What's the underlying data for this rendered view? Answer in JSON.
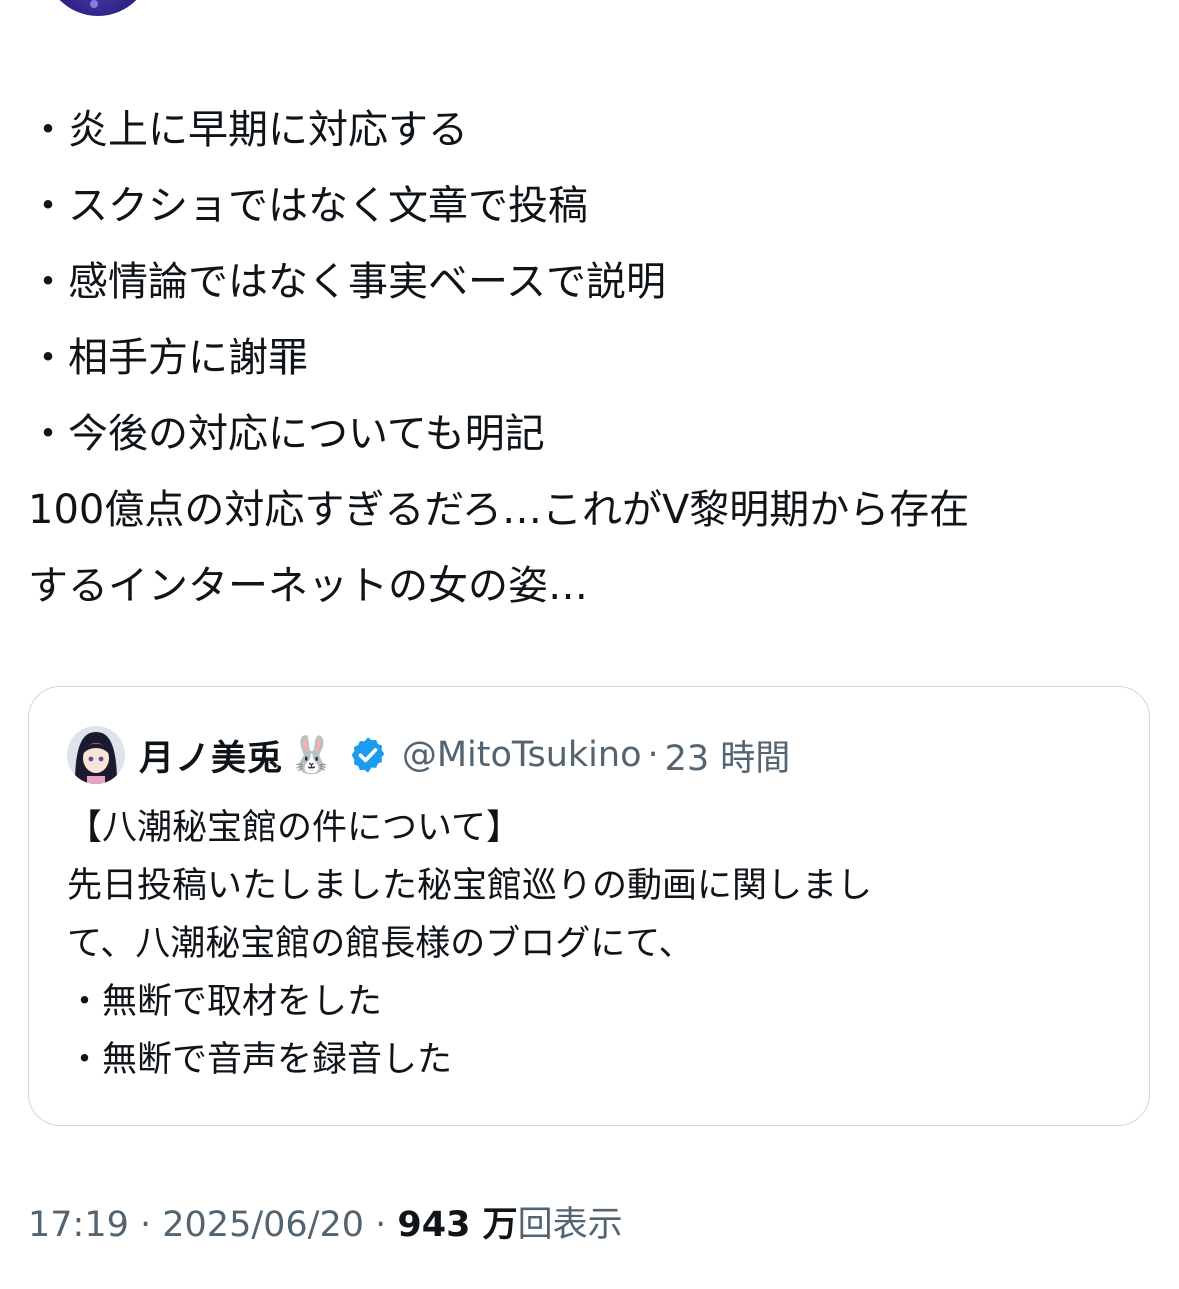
{
  "tweet": {
    "bullets": [
      "・炎上に早期に対応する",
      "・スクショではなく文章で投稿",
      "・感情論ではなく事実ベースで説明",
      "・相手方に謝罪",
      "・今後の対応についても明記"
    ],
    "body_lines": [
      "100億点の対応すぎるだろ…これがV黎明期から存在",
      "するインターネットの女の姿…"
    ]
  },
  "quote": {
    "name": "月ノ美兎",
    "name_emoji": "🐰",
    "handle": "@MitoTsukino",
    "separator": "·",
    "time": "23 時間",
    "lines": [
      "【八潮秘宝館の件について】",
      "先日投稿いたしました秘宝館巡りの動画に関しまし",
      "て、八潮秘宝館の館長様のブログにて、",
      "・無断で取材をした",
      "・無断で音声を録音した"
    ],
    "verified_color": "#1d9bf0"
  },
  "meta": {
    "time": "17:19",
    "sep1": " · ",
    "date": "2025/06/20",
    "sep2": " · ",
    "views_count": "943 万",
    "views_label": "回表示"
  }
}
